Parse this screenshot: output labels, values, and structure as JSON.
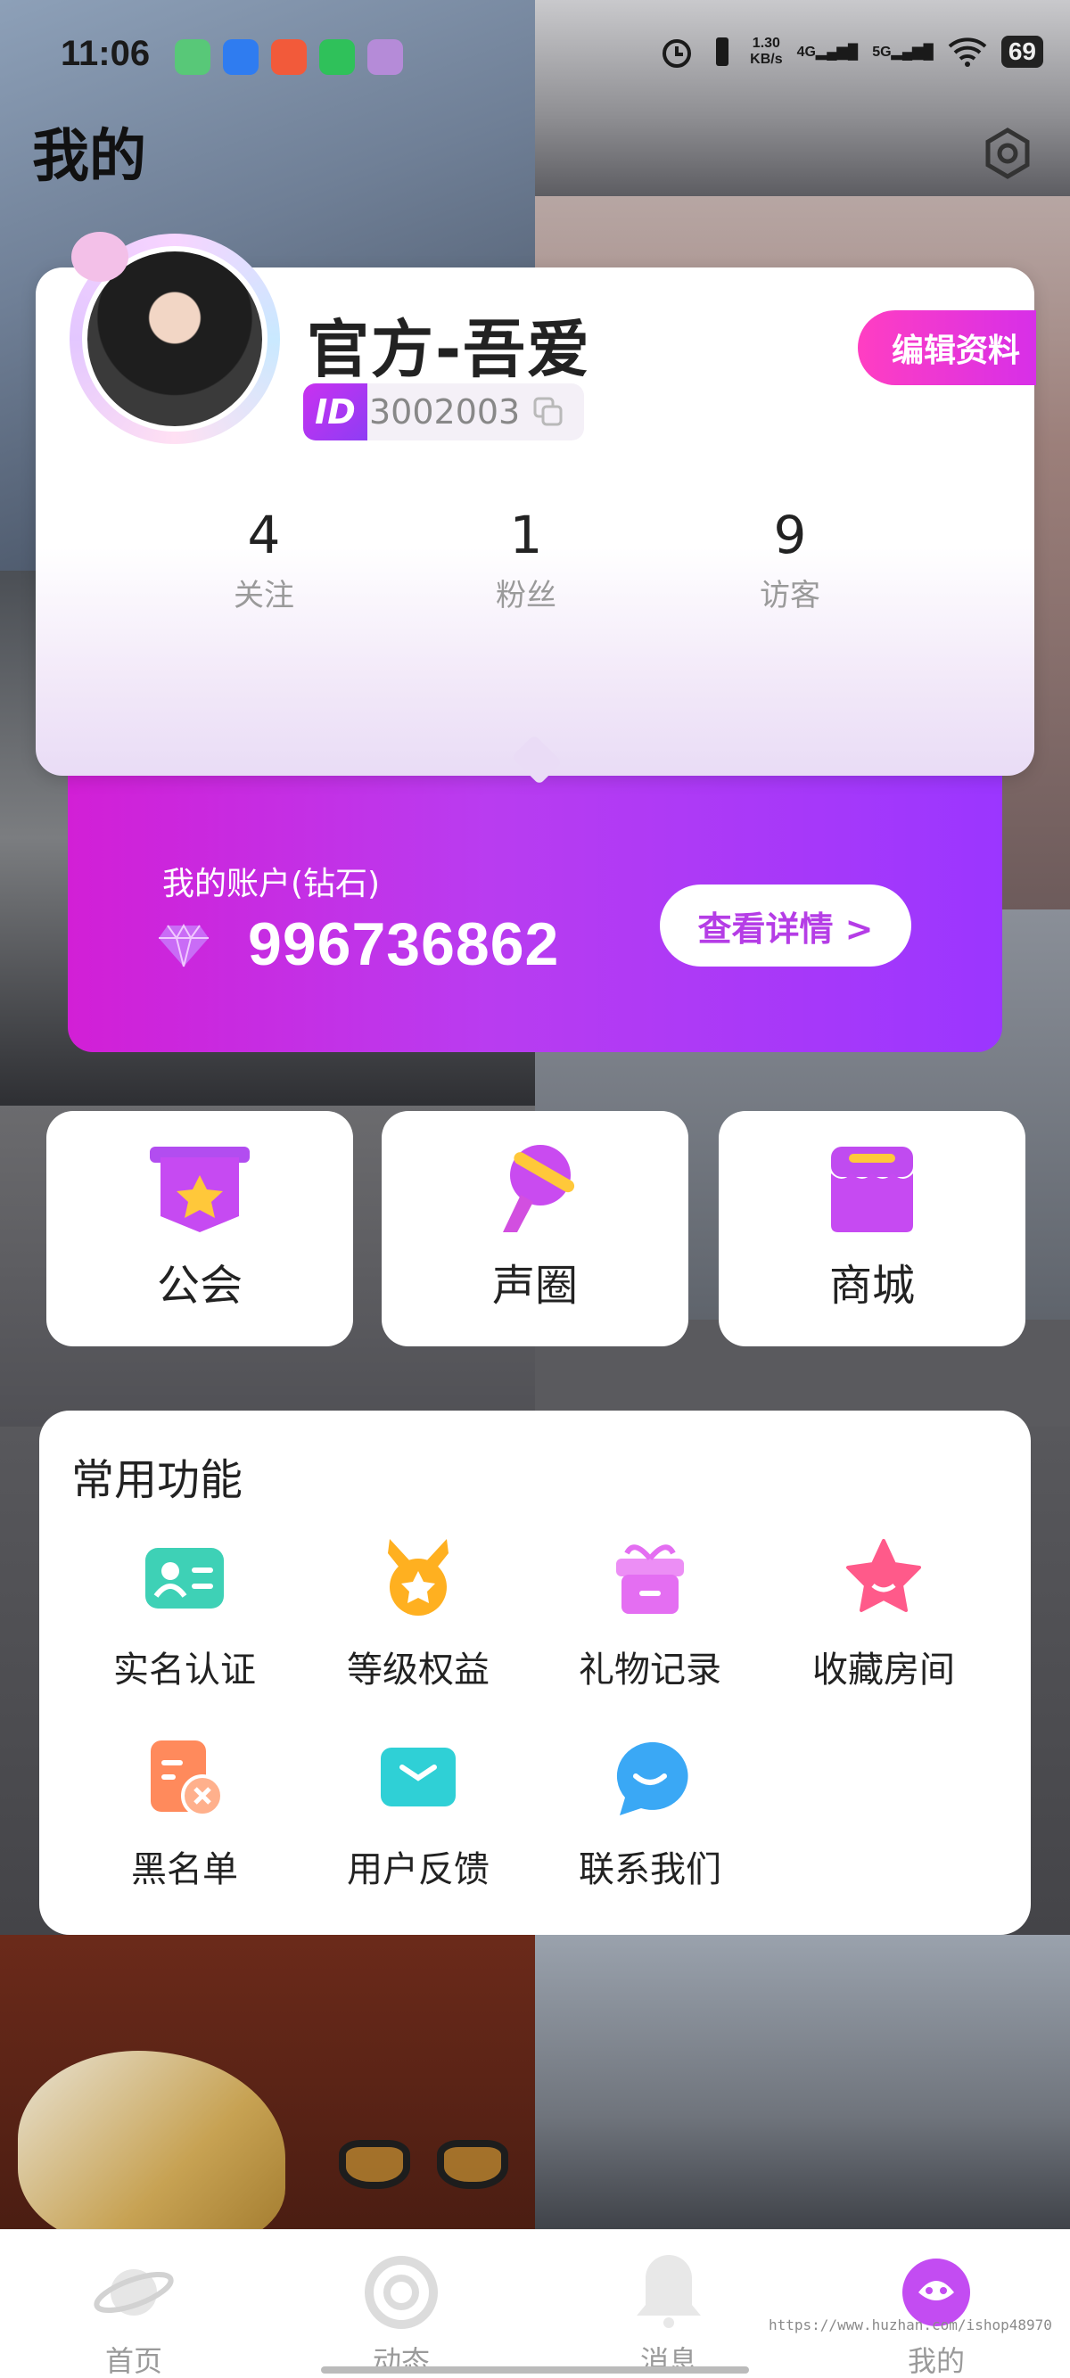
{
  "status_bar": {
    "time": "11:06",
    "net_speed_value": "1.30",
    "net_speed_unit": "KB/s",
    "sim1": "4G",
    "sim2": "5G",
    "battery": "69"
  },
  "header": {
    "title": "我的",
    "settings_icon": "hexagon-gear-icon"
  },
  "profile": {
    "nickname": "官方-吾爱",
    "edit_label": "编辑资料",
    "id_badge": "ID",
    "id_value": "3002003",
    "stats": [
      {
        "value": "4",
        "label": "关注"
      },
      {
        "value": "1",
        "label": "粉丝"
      },
      {
        "value": "9",
        "label": "访客"
      }
    ]
  },
  "account": {
    "label": "我的账户(钻石)",
    "amount": "996736862",
    "details_label": "查看详情 >"
  },
  "feature_tiles": [
    {
      "label": "公会",
      "icon": "guild-banner-icon"
    },
    {
      "label": "声圈",
      "icon": "microphone-icon"
    },
    {
      "label": "商城",
      "icon": "store-icon"
    }
  ],
  "common_functions": {
    "title": "常用功能",
    "items": [
      {
        "label": "实名认证",
        "icon": "id-card-icon",
        "color": "#3ed1b6"
      },
      {
        "label": "等级权益",
        "icon": "medal-icon",
        "color": "#ffb020"
      },
      {
        "label": "礼物记录",
        "icon": "gift-icon",
        "color": "#e46ef2"
      },
      {
        "label": "收藏房间",
        "icon": "star-icon",
        "color": "#ff5a8a"
      },
      {
        "label": "黑名单",
        "icon": "blacklist-icon",
        "color": "#ff8a5c"
      },
      {
        "label": "用户反馈",
        "icon": "mail-icon",
        "color": "#2fd0d6"
      },
      {
        "label": "联系我们",
        "icon": "chat-bubble-icon",
        "color": "#3aa8f5"
      }
    ]
  },
  "bottom_nav": {
    "items": [
      {
        "label": "首页",
        "icon": "planet-icon"
      },
      {
        "label": "动态",
        "icon": "ring-icon"
      },
      {
        "label": "消息",
        "icon": "bell-icon"
      },
      {
        "label": "我的",
        "icon": "mascot-icon",
        "active": true
      }
    ]
  },
  "watermark": "https://www.huzhan.com/ishop48970",
  "colors": {
    "accent_pink": "#d21fd6",
    "accent_purple": "#9b36ff"
  }
}
